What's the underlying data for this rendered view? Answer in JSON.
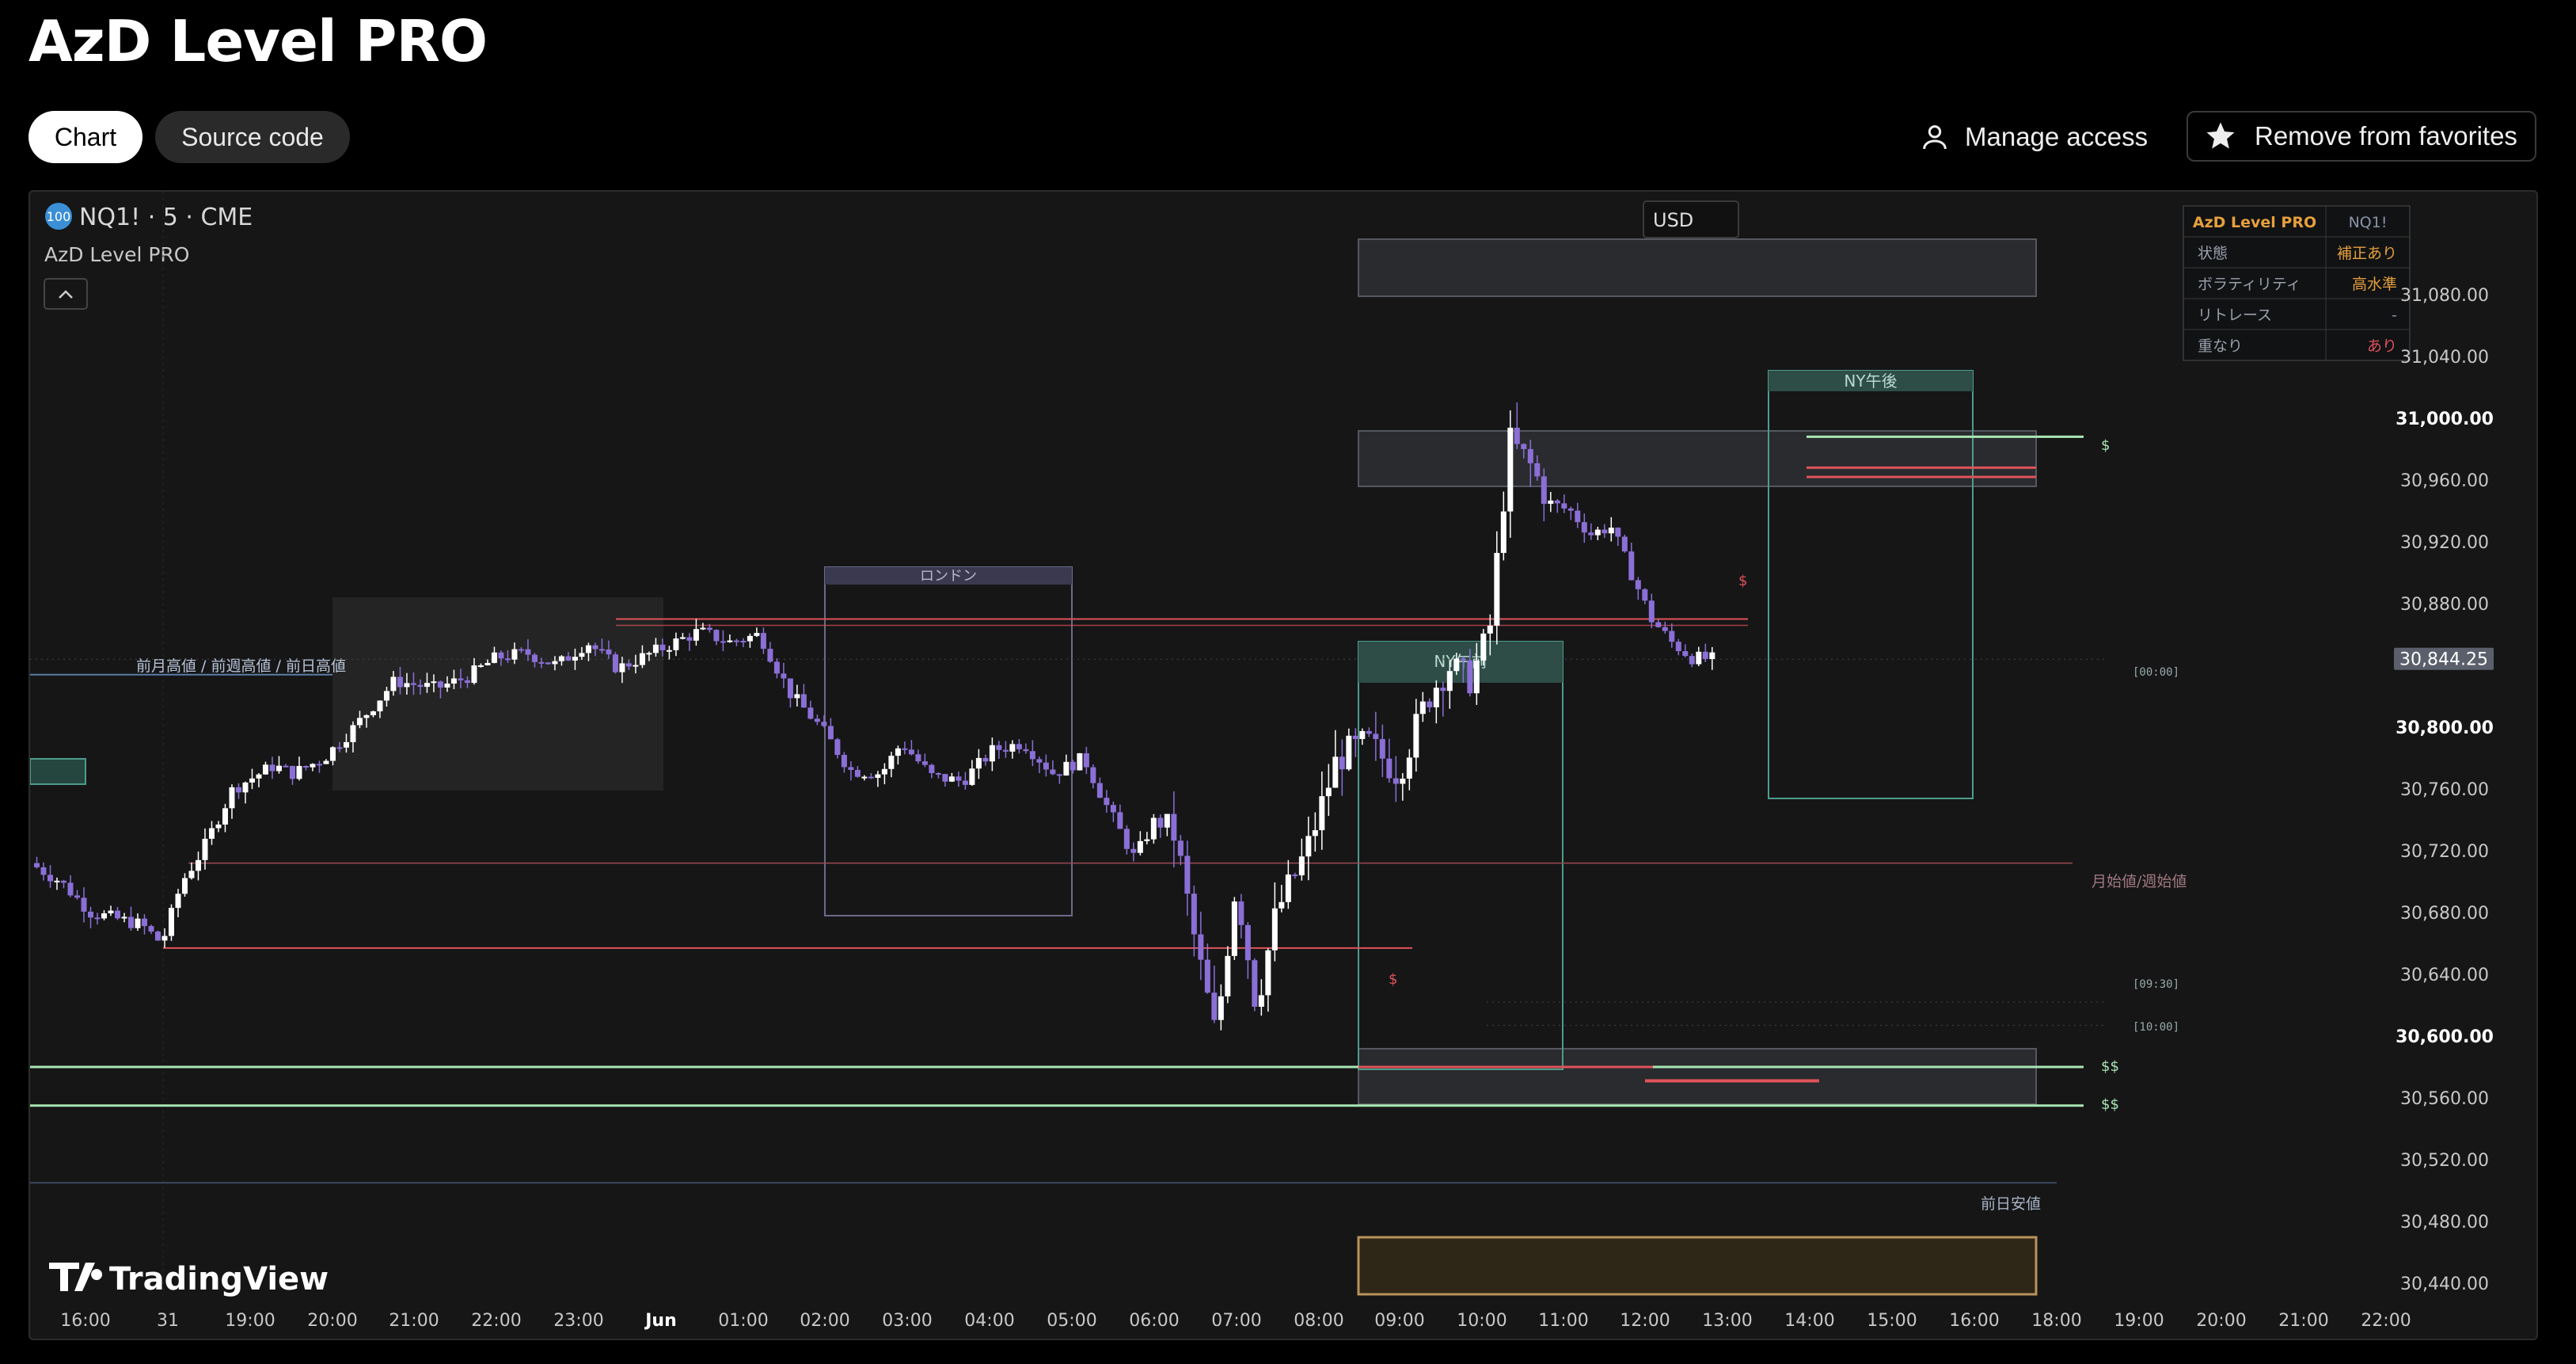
{
  "page": {
    "title": "AzD Level PRO"
  },
  "tabs": [
    {
      "label": "Chart"
    },
    {
      "label": "Source code"
    }
  ],
  "actions": {
    "manage_access": "Manage access",
    "remove_favorites": "Remove from favorites"
  },
  "chart_header": {
    "badge": "100",
    "symbol_line": "NQ1! · 5 · CME",
    "indicator_name": "AzD Level PRO",
    "currency": "USD"
  },
  "info_table": {
    "header": [
      "AzD Level PRO",
      "NQ1!"
    ],
    "rows": [
      {
        "key": "状態",
        "value": "補正あり",
        "color": "#e6a03c"
      },
      {
        "key": "ボラティリティ",
        "value": "高水準",
        "color": "#e6a03c"
      },
      {
        "key": "リトレース",
        "value": "-",
        "color": "#8a93a6"
      },
      {
        "key": "重なり",
        "value": "あり",
        "color": "#e0535a"
      }
    ]
  },
  "y_axis": {
    "ticks": [
      "31,080.00",
      "31,040.00",
      "31,000.00",
      "30,960.00",
      "30,920.00",
      "30,880.00",
      "30,800.00",
      "30,760.00",
      "30,720.00",
      "30,680.00",
      "30,640.00",
      "30,600.00",
      "30,560.00",
      "30,520.00",
      "30,480.00",
      "30,440.00"
    ],
    "bold_ticks": [
      "31,000.00",
      "30,800.00",
      "30,600.00"
    ],
    "last_price": "30,844.25"
  },
  "x_axis": {
    "ticks": [
      "16:00",
      "31",
      "19:00",
      "20:00",
      "21:00",
      "22:00",
      "23:00",
      "Jun",
      "01:00",
      "02:00",
      "03:00",
      "04:00",
      "05:00",
      "06:00",
      "07:00",
      "08:00",
      "09:00",
      "10:00",
      "11:00",
      "12:00",
      "13:00",
      "14:00",
      "15:00",
      "16:00",
      "18:00",
      "19:00",
      "20:00",
      "21:00",
      "22:00"
    ],
    "bold_ticks": [
      "Jun"
    ]
  },
  "labels": {
    "london": "ロンドン",
    "ny_am": "NY午前",
    "ny_pm": "NY午後",
    "prev_highs": "前月高値 / 前週高値 / 前日高値",
    "month_open": "月始値/週始値",
    "prev_day_low": "前日安値",
    "t0000": "[00:00]",
    "t0930": "[09:30]",
    "t1000": "[10:00]",
    "liq_single": "$",
    "liq_double": "$$"
  },
  "watermark": "TradingView",
  "colors": {
    "candle_up": "#ffffff",
    "candle_down": "#8b6fd6",
    "resistance": "#e0535a",
    "support_liquidity": "#a8e6b4",
    "session_box": "#4f9b8c",
    "london_box": "#6b6a8a",
    "premium_zone": "#b8935a"
  },
  "chart_data": {
    "type": "candlestick",
    "symbol": "NQ1!",
    "interval": "5",
    "exchange": "CME",
    "ylim": [
      30420,
      31120
    ],
    "x_range": [
      "16:00",
      "22:00"
    ],
    "last_price": 30844.25,
    "key_levels": {
      "prev_high_line": 30834,
      "london_high": 30870,
      "month_week_open": 30712,
      "range_low": 30657,
      "liquidity_high": 30988,
      "liquidity_low_1": 30580,
      "liquidity_low_2": 30555,
      "prev_day_low": 30505
    },
    "path_points": [
      [
        0,
        30712
      ],
      [
        0.015,
        30700
      ],
      [
        0.03,
        30680
      ],
      [
        0.055,
        30672
      ],
      [
        0.065,
        30660
      ],
      [
        0.075,
        30700
      ],
      [
        0.085,
        30720
      ],
      [
        0.1,
        30760
      ],
      [
        0.12,
        30775
      ],
      [
        0.13,
        30770
      ],
      [
        0.145,
        30780
      ],
      [
        0.16,
        30800
      ],
      [
        0.18,
        30830
      ],
      [
        0.2,
        30825
      ],
      [
        0.215,
        30832
      ],
      [
        0.23,
        30845
      ],
      [
        0.245,
        30848
      ],
      [
        0.26,
        30840
      ],
      [
        0.275,
        30855
      ],
      [
        0.29,
        30838
      ],
      [
        0.31,
        30850
      ],
      [
        0.33,
        30862
      ],
      [
        0.345,
        30855
      ],
      [
        0.36,
        30860
      ],
      [
        0.375,
        30822
      ],
      [
        0.39,
        30800
      ],
      [
        0.405,
        30772
      ],
      [
        0.42,
        30770
      ],
      [
        0.43,
        30790
      ],
      [
        0.445,
        30768
      ],
      [
        0.46,
        30765
      ],
      [
        0.475,
        30785
      ],
      [
        0.49,
        30790
      ],
      [
        0.505,
        30770
      ],
      [
        0.52,
        30780
      ],
      [
        0.53,
        30752
      ],
      [
        0.545,
        30715
      ],
      [
        0.555,
        30740
      ],
      [
        0.565,
        30730
      ],
      [
        0.575,
        30660
      ],
      [
        0.585,
        30600
      ],
      [
        0.595,
        30700
      ],
      [
        0.605,
        30620
      ],
      [
        0.615,
        30680
      ],
      [
        0.63,
        30720
      ],
      [
        0.645,
        30780
      ],
      [
        0.66,
        30790
      ],
      [
        0.675,
        30770
      ],
      [
        0.69,
        30820
      ],
      [
        0.7,
        30840
      ],
      [
        0.71,
        30830
      ],
      [
        0.72,
        30860
      ],
      [
        0.73,
        30985
      ],
      [
        0.74,
        30970
      ],
      [
        0.75,
        30945
      ],
      [
        0.76,
        30940
      ],
      [
        0.77,
        30925
      ],
      [
        0.78,
        30930
      ],
      [
        0.79,
        30900
      ],
      [
        0.8,
        30870
      ],
      [
        0.81,
        30855
      ],
      [
        0.82,
        30845
      ],
      [
        0.83,
        30844
      ]
    ]
  }
}
